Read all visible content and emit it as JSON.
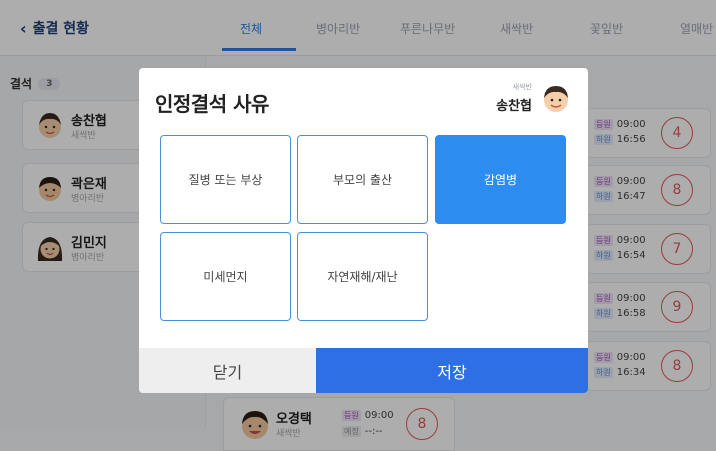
{
  "header": {
    "back_label": "출결 현황",
    "tabs": [
      {
        "label": "전체",
        "active": true
      },
      {
        "label": "병아리반",
        "active": false
      },
      {
        "label": "푸른나무반",
        "active": false
      },
      {
        "label": "새싹반",
        "active": false
      },
      {
        "label": "꽃잎반",
        "active": false
      },
      {
        "label": "열매반",
        "active": false
      }
    ]
  },
  "absent_panel": {
    "title": "결석",
    "count": "3",
    "students": [
      {
        "name": "송찬협",
        "class": "새싹반"
      },
      {
        "name": "곽은재",
        "class": "병아리반"
      },
      {
        "name": "김민지",
        "class": "병아리반"
      }
    ]
  },
  "attendance_cards": [
    {
      "in_tag": "등원",
      "in_time": "09:00",
      "out_tag": "하원",
      "out_time": "16:56",
      "count": "4"
    },
    {
      "in_tag": "등원",
      "in_time": "09:00",
      "out_tag": "하원",
      "out_time": "16:47",
      "count": "8"
    },
    {
      "in_tag": "등원",
      "in_time": "09:00",
      "out_tag": "하원",
      "out_time": "16:54",
      "count": "7"
    },
    {
      "in_tag": "등원",
      "in_time": "09:00",
      "out_tag": "하원",
      "out_time": "16:58",
      "count": "9"
    },
    {
      "in_tag": "등원",
      "in_time": "09:00",
      "out_tag": "하원",
      "out_time": "16:34",
      "count": "8"
    }
  ],
  "bottom_card": {
    "name": "오경택",
    "class": "새싹반",
    "in_tag": "등원",
    "in_time": "09:00",
    "out_tag": "예정",
    "out_time": "--:--",
    "count": "8"
  },
  "modal": {
    "title": "인정결석 사유",
    "class_label": "새싹반",
    "student_name": "송찬협",
    "reasons": [
      {
        "label": "질병 또는 부상",
        "selected": false
      },
      {
        "label": "부모의 출산",
        "selected": false
      },
      {
        "label": "감염병",
        "selected": true
      },
      {
        "label": "미세먼지",
        "selected": false
      },
      {
        "label": "자연재해/재난",
        "selected": false
      }
    ],
    "close_label": "닫기",
    "save_label": "저장"
  },
  "colors": {
    "accent": "#2d8cf0",
    "save": "#2e6fe6",
    "ring": "#e35a58",
    "nav_title": "#1f3e7a"
  }
}
